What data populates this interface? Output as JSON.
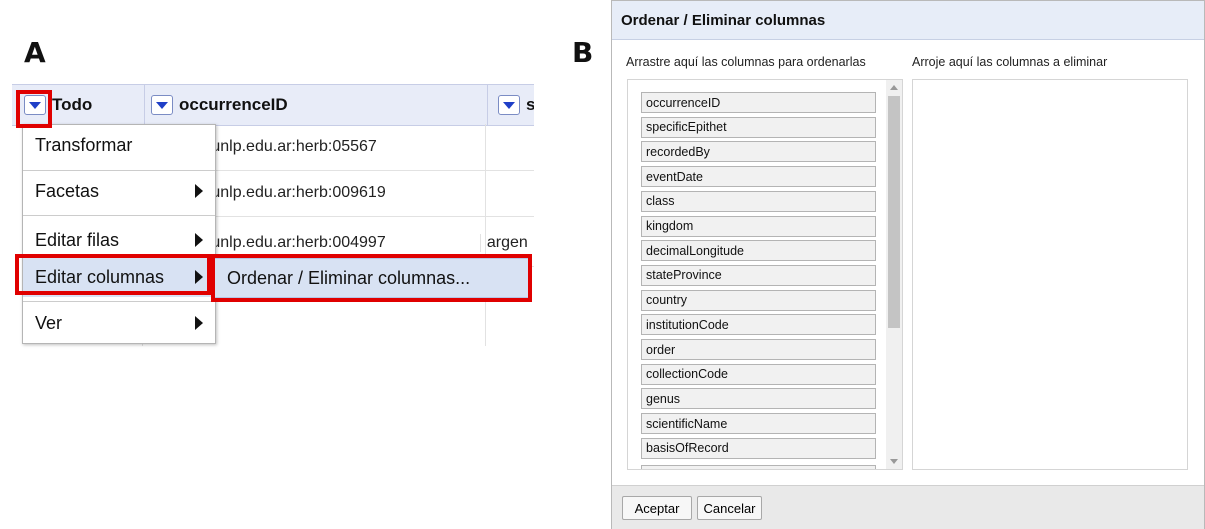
{
  "panel_a": {
    "letter": "A",
    "headers": [
      {
        "label": "Todo"
      },
      {
        "label": "occurrenceID"
      },
      {
        "label": "s"
      }
    ],
    "rows": [
      {
        "id": "og:fcnym.unlp.edu.ar:herb:05567",
        "next": ""
      },
      {
        "id": "og:fcnym.unlp.edu.ar:herb:009619",
        "next": ""
      },
      {
        "id": "og:fcnym.unlp.edu.ar:herb:004997",
        "next": "argen"
      }
    ],
    "menu": [
      {
        "label": "Transformar",
        "has_submenu": false
      },
      {
        "label": "Facetas",
        "has_submenu": true
      },
      {
        "label": "Editar filas",
        "has_submenu": true
      },
      {
        "label": "Editar columnas",
        "has_submenu": true
      },
      {
        "label": "Ver",
        "has_submenu": true
      }
    ],
    "submenu_item": "Ordenar / Eliminar columnas...",
    "highlight_color": "#e00000"
  },
  "panel_b": {
    "letter": "B",
    "title": "Ordenar / Eliminar columnas",
    "left_heading": "Arrastre aquí las columnas para ordenarlas",
    "right_heading": "Arroje aquí las columnas a eliminar",
    "columns": [
      "occurrenceID",
      "specificEpithet",
      "recordedBy",
      "eventDate",
      "class",
      "kingdom",
      "decimalLongitude",
      "stateProvince",
      "country",
      "institutionCode",
      "order",
      "collectionCode",
      "genus",
      "scientificName",
      "basisOfRecord"
    ],
    "buttons": {
      "ok": "Aceptar",
      "cancel": "Cancelar"
    }
  }
}
